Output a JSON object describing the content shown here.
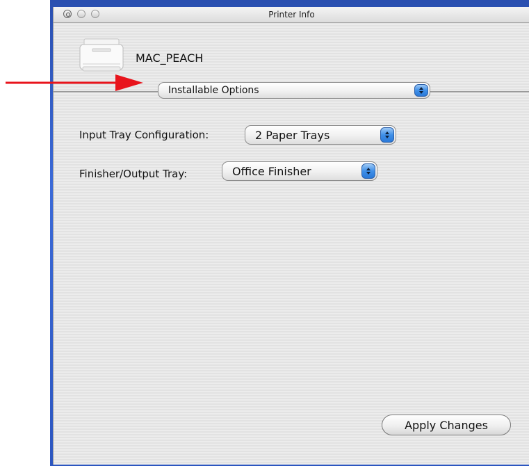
{
  "window": {
    "title": "Printer Info"
  },
  "printer": {
    "name": "MAC_PEACH"
  },
  "section_popup": {
    "selected": "Installable Options"
  },
  "options": [
    {
      "label": "Input Tray Configuration:",
      "selected": "2 Paper Trays"
    },
    {
      "label": "Finisher/Output Tray:",
      "selected": "Office Finisher"
    }
  ],
  "footer": {
    "apply_label": "Apply Changes"
  },
  "colors": {
    "annotation_arrow": "#e8141c",
    "stepper_blue": "#3f8fe8",
    "desktop_blue": "#2c56c0"
  },
  "icons": {
    "printer": "printer-icon",
    "annotation": "red-arrow-icon"
  }
}
